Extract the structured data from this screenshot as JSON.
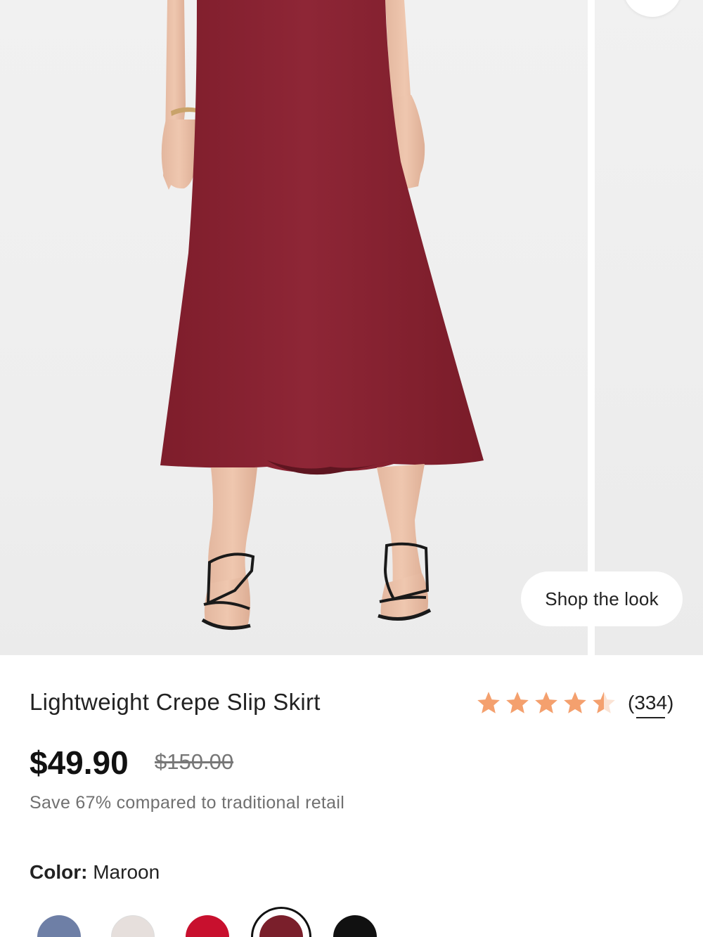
{
  "gallery": {
    "shop_the_look_label": "Shop the look"
  },
  "product": {
    "title": "Lightweight Crepe Slip Skirt",
    "rating": {
      "stars": 4.5,
      "count_label": "(334)",
      "star_color": "#F4A06E"
    },
    "price": "$49.90",
    "original_price": "$150.00",
    "savings_text": "Save 67% compared to traditional retail",
    "color": {
      "label": "Color:",
      "value": "Maroon",
      "swatches": [
        {
          "name": "slate-blue",
          "hex": "#6E7FA6",
          "selected": false
        },
        {
          "name": "floral-print",
          "hex": "#E6DFDC",
          "selected": false
        },
        {
          "name": "red",
          "hex": "#C8102E",
          "selected": false
        },
        {
          "name": "maroon",
          "hex": "#7A1F2B",
          "selected": true
        },
        {
          "name": "black",
          "hex": "#111111",
          "selected": false
        }
      ]
    }
  },
  "colors": {
    "skirt": "#8B2332",
    "background": "#EFEFEF"
  }
}
